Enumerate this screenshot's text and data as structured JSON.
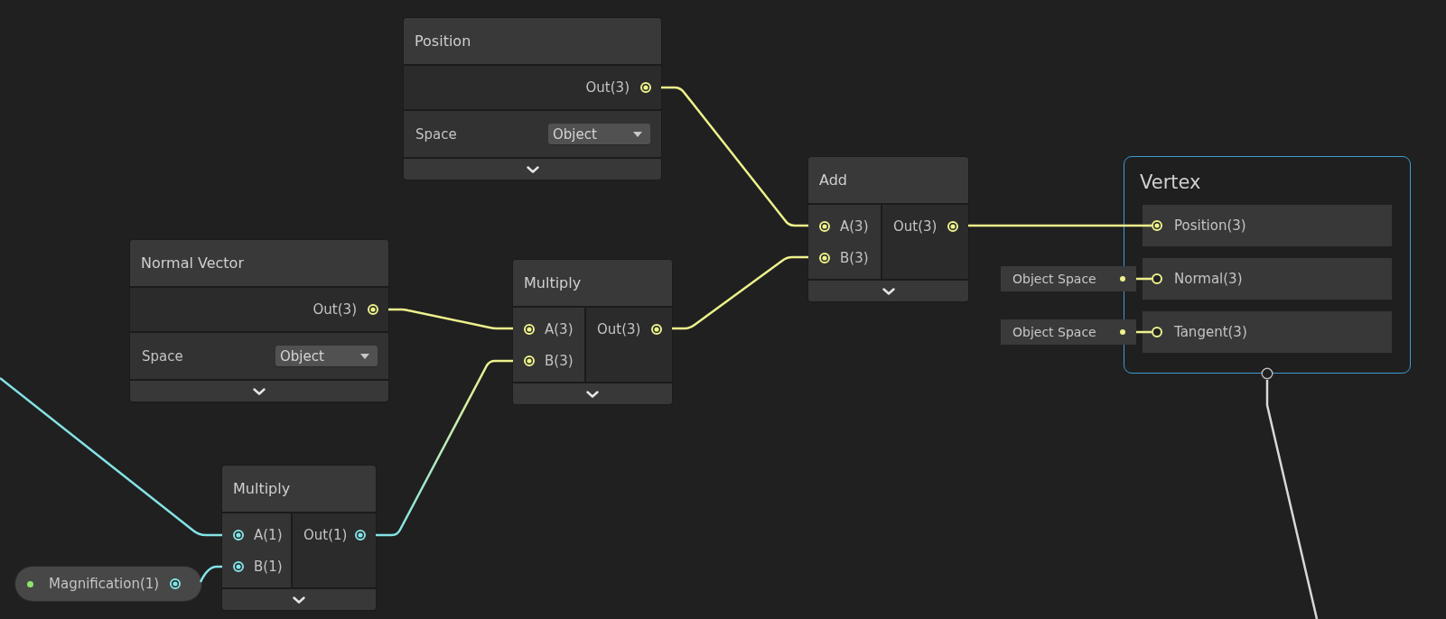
{
  "nodes": [
    {
      "kind": "source",
      "title": "Position",
      "selected": false,
      "outputs": [
        {
          "label": "Out(3)",
          "color": "#eef28c",
          "connected": true
        }
      ],
      "properties": [
        {
          "label": "Space",
          "value": "Object"
        }
      ],
      "preview_expanded": false
    },
    {
      "kind": "operator",
      "title": "Add",
      "selected": false,
      "inputs": [
        {
          "label": "A(3)",
          "color": "#eef28c",
          "connected": true
        },
        {
          "label": "B(3)",
          "color": "#eef28c",
          "connected": true
        }
      ],
      "outputs": [
        {
          "label": "Out(3)",
          "color": "#eef28c",
          "connected": true
        }
      ],
      "preview_expanded": false
    },
    {
      "kind": "source",
      "title": "Normal Vector",
      "selected": false,
      "outputs": [
        {
          "label": "Out(3)",
          "color": "#eef28c",
          "connected": true
        }
      ],
      "properties": [
        {
          "label": "Space",
          "value": "Object"
        }
      ],
      "preview_expanded": false
    },
    {
      "kind": "operator",
      "title": "Multiply",
      "selected": false,
      "inputs": [
        {
          "label": "A(3)",
          "color": "#eef28c",
          "connected": true
        },
        {
          "label": "B(3)",
          "color": "#eef28c",
          "connected": true
        }
      ],
      "outputs": [
        {
          "label": "Out(3)",
          "color": "#eef28c",
          "connected": true
        }
      ],
      "preview_expanded": false
    },
    {
      "kind": "operator",
      "title": "Multiply",
      "selected": false,
      "inputs": [
        {
          "label": "A(1)",
          "color": "#84e3e6",
          "connected": true
        },
        {
          "label": "B(1)",
          "color": "#84e3e6",
          "connected": true
        }
      ],
      "outputs": [
        {
          "label": "Out(1)",
          "color": "#84e3e6",
          "connected": true
        }
      ],
      "preview_expanded": false
    }
  ],
  "vertex_block": {
    "title": "Vertex",
    "selected": true,
    "slots": [
      {
        "label": "Position(3)",
        "color": "#eef28c",
        "connected": true
      },
      {
        "label": "Normal(3)",
        "color": "#eef28c",
        "connected": false,
        "default": "Object Space"
      },
      {
        "label": "Tangent(3)",
        "color": "#eef28c",
        "connected": false,
        "default": "Object Space"
      }
    ]
  },
  "property_node": {
    "label": "Magnification(1)",
    "exposed": true,
    "selected": false,
    "port": {
      "color": "#84e3e6",
      "connected": true
    }
  }
}
